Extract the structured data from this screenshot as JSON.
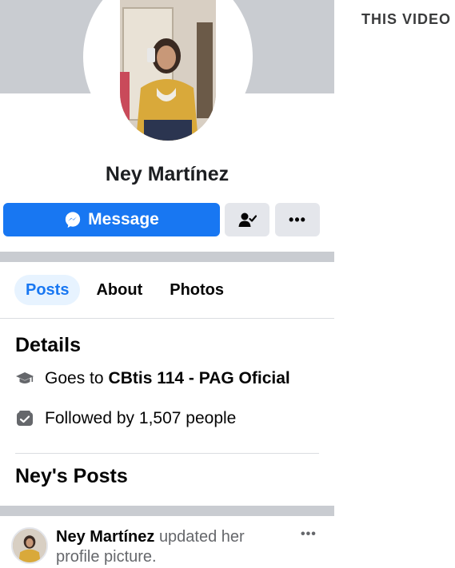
{
  "profile": {
    "name": "Ney Martínez"
  },
  "actions": {
    "message_label": "Message"
  },
  "tabs": [
    {
      "label": "Posts",
      "active": true
    },
    {
      "label": "About",
      "active": false
    },
    {
      "label": "Photos",
      "active": false
    }
  ],
  "details": {
    "title": "Details",
    "school_prefix": "Goes to",
    "school_name": "CBtis 114 - PAG Oficial",
    "followers_text": "Followed by 1,507 people"
  },
  "posts": {
    "title": "Ney's Posts",
    "items": [
      {
        "author": "Ney Martínez",
        "action": "updated her profile picture."
      }
    ]
  },
  "overlay": {
    "watermark_text": "THIS VIDEO"
  },
  "colors": {
    "accent": "#1877f2",
    "cover": "#c9ccd1",
    "button_gray": "#e4e6eb"
  },
  "icons": {
    "message_button": "messenger-icon",
    "friend_button": "friend-check-icon",
    "more_button": "more-dots-icon",
    "school": "graduation-cap-icon",
    "followers": "followers-icon"
  }
}
